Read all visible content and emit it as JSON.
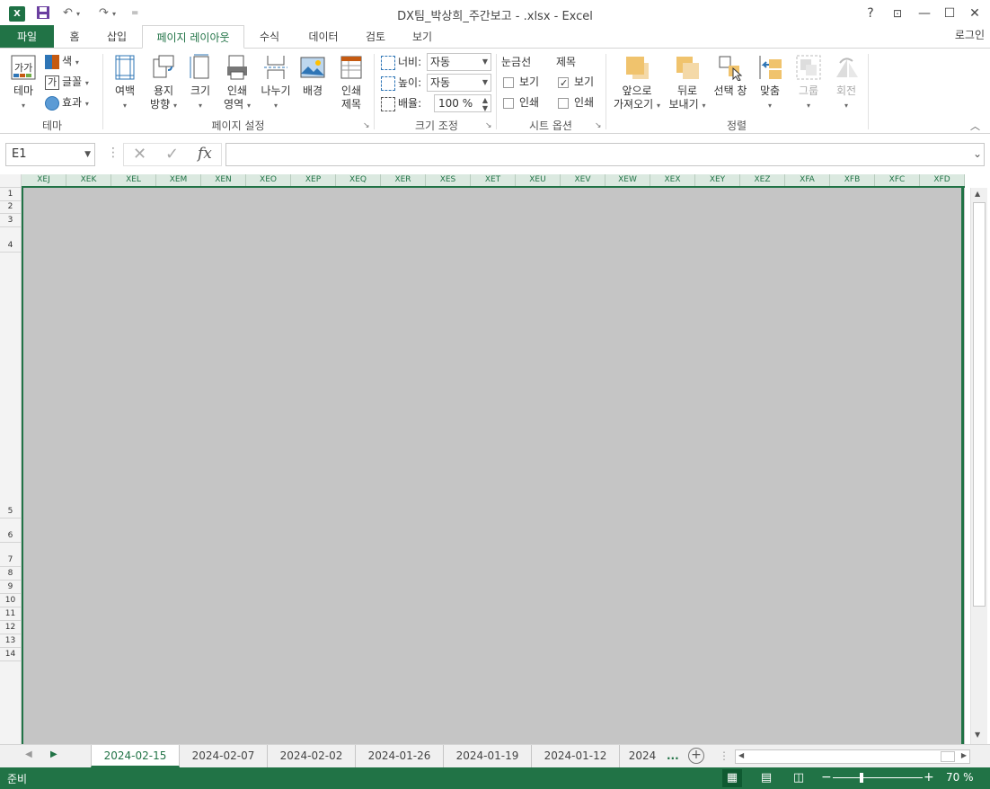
{
  "window": {
    "title": "DX팀_박상희_주간보고 - .xlsx - Excel",
    "app_icon": "X",
    "buttons": {
      "help": "?",
      "ribbon_display": "⊡",
      "minimize": "—",
      "maximize": "☐",
      "close": "✕"
    }
  },
  "qat": {
    "save": "save-icon",
    "undo": "undo-icon",
    "redo": "redo-icon",
    "customize": "="
  },
  "tabs": [
    {
      "label": "파일"
    },
    {
      "label": "홈"
    },
    {
      "label": "삽입"
    },
    {
      "label": "페이지 레이아웃"
    },
    {
      "label": "수식"
    },
    {
      "label": "데이터"
    },
    {
      "label": "검토"
    },
    {
      "label": "보기"
    }
  ],
  "login": "로그인",
  "ribbon": {
    "theme": {
      "group": "테마",
      "theme_label": "테마",
      "colors": "색",
      "fonts": "글꼴",
      "effects": "효과"
    },
    "page_setup": {
      "group": "페이지 설정",
      "margins": "여백",
      "orientation_1": "용지",
      "orientation_2": "방향",
      "size": "크기",
      "print_area_1": "인쇄",
      "print_area_2": "영역",
      "breaks": "나누기",
      "background": "배경",
      "print_titles_1": "인쇄",
      "print_titles_2": "제목"
    },
    "scale": {
      "group": "크기 조정",
      "width_label": "너비:",
      "width_value": "자동",
      "height_label": "높이:",
      "height_value": "자동",
      "scale_label": "배율:",
      "scale_value": "100 %"
    },
    "sheet_options": {
      "group": "시트 옵션",
      "gridlines": "눈금선",
      "headings": "제목",
      "view": "보기",
      "print": "인쇄",
      "gridlines_view": false,
      "gridlines_print": false,
      "headings_view": true,
      "headings_print": false
    },
    "arrange": {
      "group": "정렬",
      "bring_forward_1": "앞으로",
      "bring_forward_2": "가져오기",
      "send_backward_1": "뒤로",
      "send_backward_2": "보내기",
      "selection_pane": "선택 창",
      "align": "맞춤",
      "group_btn": "그룹",
      "rotate": "회전"
    }
  },
  "formula_bar": {
    "name_box": "E1",
    "cancel": "✕",
    "enter": "✓",
    "fx": "fx",
    "content": ""
  },
  "columns": [
    "XEJ",
    "XEK",
    "XEL",
    "XEM",
    "XEN",
    "XEO",
    "XEP",
    "XEQ",
    "XER",
    "XES",
    "XET",
    "XEU",
    "XEV",
    "XEW",
    "XEX",
    "XEY",
    "XEZ",
    "XFA",
    "XFB",
    "XFC",
    "XFD"
  ],
  "rows": [
    "1",
    "2",
    "3",
    "4",
    "5",
    "6",
    "7",
    "8",
    "9",
    "10",
    "11",
    "12",
    "13",
    "14"
  ],
  "sheets": [
    {
      "label": "2024-02-15",
      "active": true
    },
    {
      "label": "2024-02-07"
    },
    {
      "label": "2024-02-02"
    },
    {
      "label": "2024-01-26"
    },
    {
      "label": "2024-01-19"
    },
    {
      "label": "2024-01-12"
    },
    {
      "label": "2024"
    }
  ],
  "more_sheets": "...",
  "status": {
    "ready": "준비",
    "zoom": "70 %"
  },
  "colors": {
    "accent": "#217346"
  }
}
